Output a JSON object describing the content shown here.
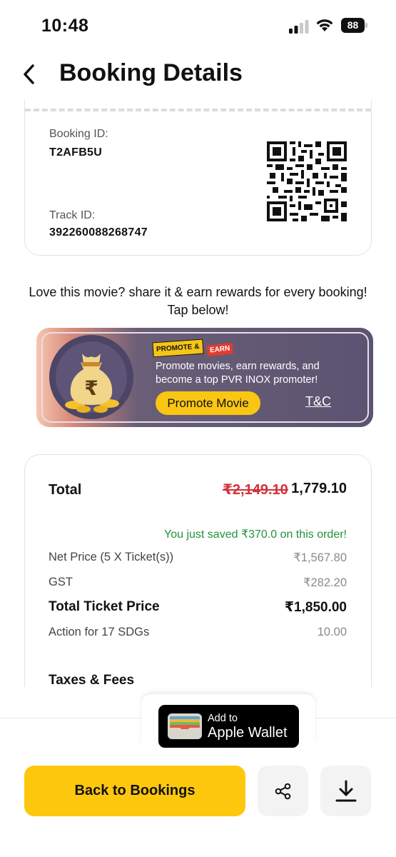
{
  "status_bar": {
    "time": "10:48",
    "battery": "88"
  },
  "header": {
    "title": "Booking Details"
  },
  "ticket": {
    "booking_id_label": "Booking ID:",
    "booking_id": "T2AFB5U",
    "track_id_label": "Track ID:",
    "track_id": "392260088268747"
  },
  "share_prompt": "Love this movie? share it & earn rewards for every booking! Tap below!",
  "promo_banner": {
    "badge_promote": "PROMOTE &",
    "badge_earn": "EARN",
    "description": "Promote movies, earn rewards, and become a top PVR INOX promoter!",
    "button_label": "Promote Movie",
    "tnc_label": "T&C"
  },
  "price": {
    "total_label": "Total",
    "original_total": "₹2,149.10",
    "total": "1,779.10",
    "saved_text": "You just saved ₹370.0 on this order!",
    "rows": [
      {
        "label": "Net Price (5 X Ticket(s))",
        "value": "₹1,567.80"
      },
      {
        "label": "GST",
        "value": "₹282.20"
      },
      {
        "label": "Total Ticket Price",
        "value": "₹1,850.00"
      },
      {
        "label": "Action for 17 SDGs",
        "value": "10.00"
      }
    ],
    "taxes_label": "Taxes & Fees"
  },
  "wallet": {
    "small_text": "Add to",
    "big_text": "Apple Wallet"
  },
  "footer": {
    "back_button": "Back to Bookings"
  },
  "colors": {
    "accent": "#fcc70d",
    "strike": "#d0343c",
    "saved": "#22923a",
    "banner": "#5b5371"
  }
}
